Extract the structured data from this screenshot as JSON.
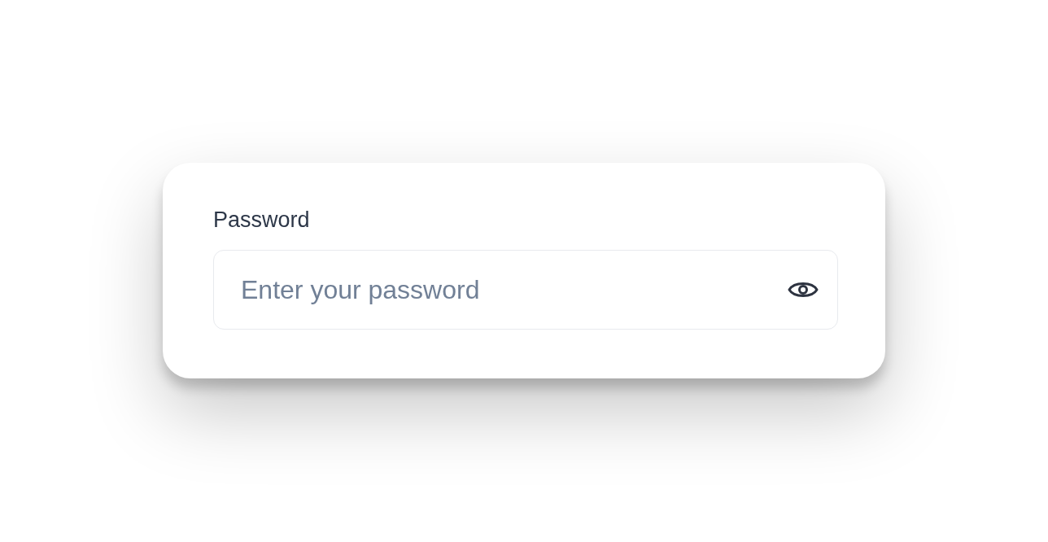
{
  "password_field": {
    "label": "Password",
    "placeholder": "Enter your password"
  }
}
